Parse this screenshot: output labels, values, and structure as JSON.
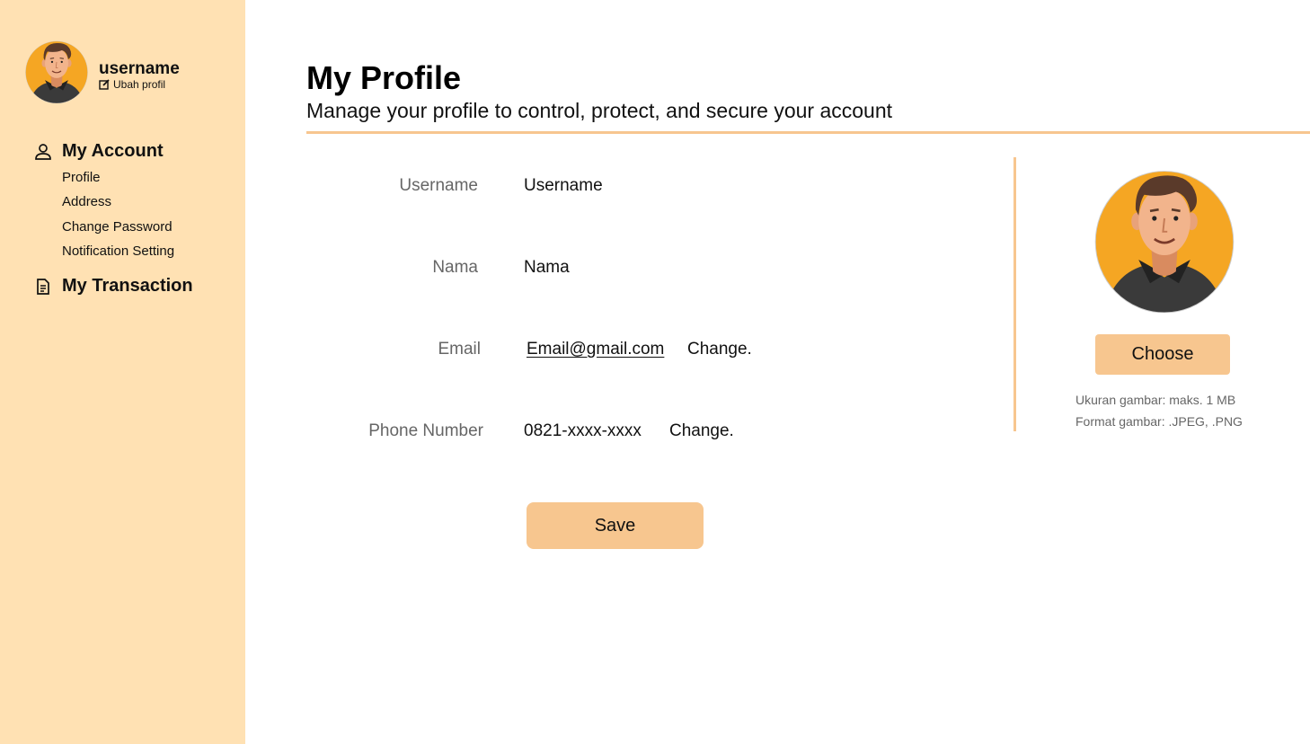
{
  "sidebar": {
    "username": "username",
    "edit_profile_label": "Ubah profil",
    "account_group": {
      "label": "My Account",
      "items": [
        {
          "label": "Profile"
        },
        {
          "label": "Address"
        },
        {
          "label": "Change Password"
        },
        {
          "label": "Notification Setting"
        }
      ]
    },
    "transaction_group": {
      "label": "My Transaction"
    }
  },
  "header": {
    "title": "My Profile",
    "subtitle": "Manage your profile to control, protect, and secure your account"
  },
  "form": {
    "username": {
      "label": "Username",
      "value": "Username"
    },
    "nama": {
      "label": "Nama",
      "value": "Nama"
    },
    "email": {
      "label": "Email",
      "value": "Email@gmail.com",
      "change_label": "Change."
    },
    "phone": {
      "label": "Phone Number",
      "value": "0821-xxxx-xxxx",
      "change_label": "Change."
    },
    "save_label": "Save"
  },
  "photo": {
    "choose_label": "Choose",
    "size_hint": "Ukuran gambar: maks. 1 MB",
    "format_hint": "Format gambar: .JPEG, .PNG"
  },
  "colors": {
    "sidebar_bg": "#ffe1b3",
    "accent": "#f7c68f",
    "avatar_bg": "#f5a623"
  },
  "icons": {
    "account": "user-icon",
    "transaction": "document-icon",
    "edit": "edit-icon"
  }
}
